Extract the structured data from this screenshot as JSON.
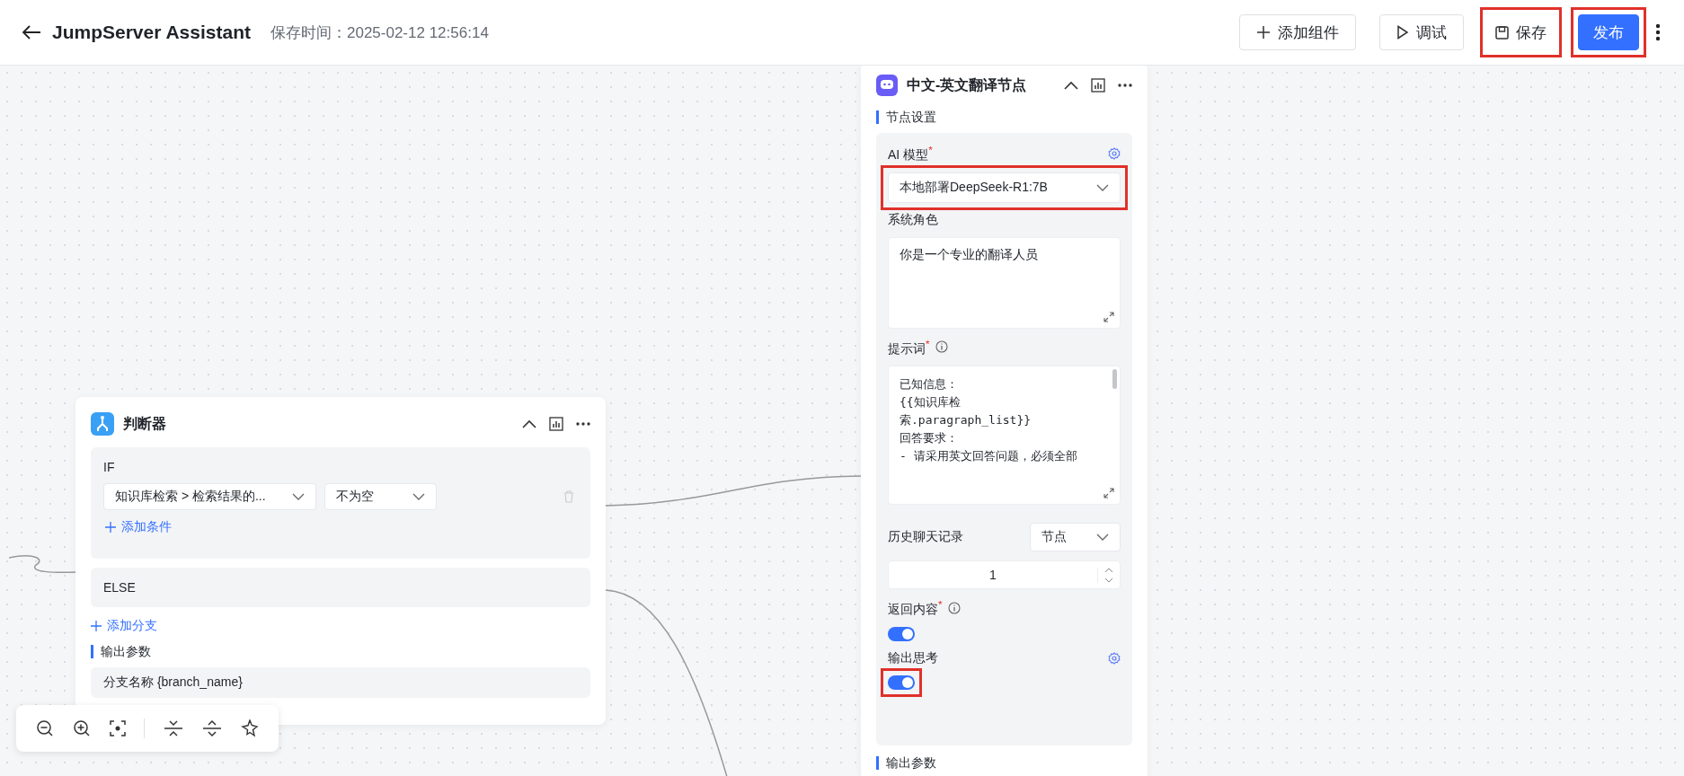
{
  "header": {
    "title": "JumpServer Assistant",
    "save_time": "保存时间：2025-02-12 12:56:14",
    "buttons": [
      {
        "kind": "add",
        "label": "添加组件",
        "highlighted": false
      },
      {
        "kind": "debug",
        "label": "调试",
        "highlighted": false
      },
      {
        "kind": "save",
        "label": "保存",
        "highlighted": true
      },
      {
        "kind": "publish",
        "label": "发布",
        "highlighted": true
      }
    ]
  },
  "condition_node": {
    "title": "判断器",
    "if_label": "IF",
    "condition_field": "知识库检索 > 检索结果的...",
    "condition_operator": "不为空",
    "add_condition": "添加条件",
    "else_label": "ELSE",
    "add_branch": "添加分支",
    "output_section": "输出参数",
    "output_row": "分支名称 {branch_name}"
  },
  "ai_node": {
    "title": "中文-英文翻译节点",
    "settings_section": "节点设置",
    "model": {
      "label": "AI 模型$^{*}$",
      "value": "本地部署DeepSeek-R1:7B",
      "highlighted": true
    },
    "system_role": {
      "label": "系统角色",
      "value": "你是一个专业的翻译人员"
    },
    "prompt": {
      "label": "提示词$^{*}$",
      "lines": [
        "已知信息：",
        "{{知识库检",
        "索.paragraph_list}}",
        "回答要求：",
        "- 请采用英文回答问题，必须全部"
      ]
    },
    "history": {
      "label": "历史聊天记录",
      "mode": "节点",
      "count": "1"
    },
    "return_content": {
      "label": "返回内容$^{*}$",
      "on": true,
      "highlighted": false
    },
    "output_thinking": {
      "label": "输出思考",
      "on": true,
      "highlighted": true
    },
    "output_section": "输出参数"
  }
}
